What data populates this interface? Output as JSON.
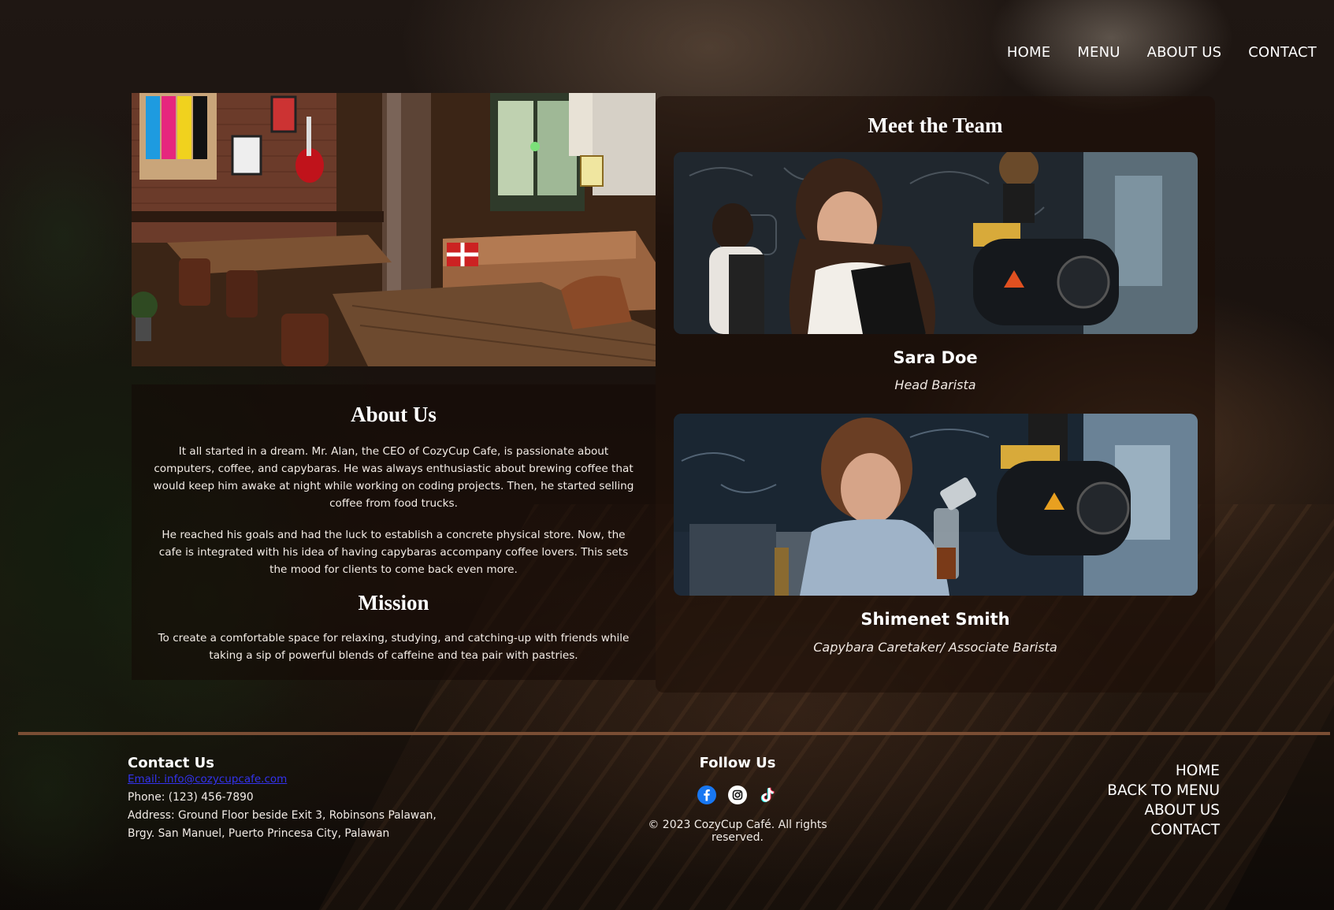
{
  "nav": {
    "items": [
      "HOME",
      "MENU",
      "ABOUT US",
      "CONTACT"
    ]
  },
  "about": {
    "heading": "About Us",
    "paragraph1": "It all started in a dream. Mr. Alan, the CEO of CozyCup Cafe, is passionate about computers, coffee, and capybaras. He was always enthusiastic about brewing coffee that would keep him awake at night while working on coding projects. Then, he started selling coffee from food trucks.",
    "paragraph2": "He reached his goals and had the luck to establish a concrete physical store. Now, the cafe is integrated with his idea of having capybaras accompany coffee lovers. This sets the mood for clients to come back even more.",
    "mission_heading": "Mission",
    "mission_text": "To create a comfortable space for relaxing, studying, and catching-up with friends while taking a sip of powerful blends of caffeine and tea pair with pastries."
  },
  "team": {
    "heading": "Meet the Team",
    "members": [
      {
        "name": "Sara Doe",
        "role": "Head Barista"
      },
      {
        "name": "Shimenet Smith",
        "role": "Capybara Caretaker/ Associate Barista"
      }
    ]
  },
  "footer": {
    "contact_heading": "Contact Us",
    "email": "Email: info@cozycupcafe.com",
    "phone": "Phone: (123) 456-7890",
    "address_line1": "Address: Ground Floor beside Exit 3, Robinsons Palawan,",
    "address_line2": "Brgy. San Manuel, Puerto Princesa City, Palawan",
    "follow_heading": "Follow Us",
    "social_icons": [
      "facebook-icon",
      "instagram-icon",
      "tiktok-icon"
    ],
    "copyright": "© 2023 CozyCup Café. All rights reserved.",
    "links": [
      "HOME",
      "BACK TO MENU",
      "ABOUT US",
      "CONTACT"
    ]
  },
  "colors": {
    "divider": "#7a4e34",
    "email_link": "#3333ee",
    "facebook": "#1877f2"
  }
}
